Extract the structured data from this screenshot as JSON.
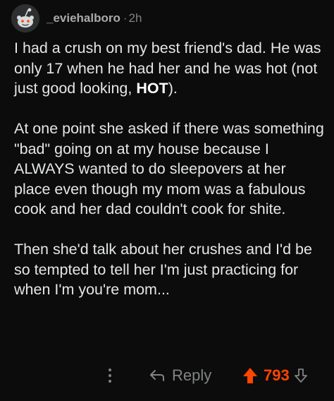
{
  "comment": {
    "author": "_eviehalboro",
    "separator": "·",
    "age": "2h",
    "avatar_icon": "reddit-snoo-avatar-icon",
    "paragraphs": [
      {
        "pre": "I had a crush on my best friend's dad. He was only 17 when he had her and he was hot (not just good looking, ",
        "strong": "HOT",
        "post": ")."
      },
      {
        "pre": "At one point she asked if there was something \"bad\" going on at my house because I ALWAYS wanted to do sleepovers at her place even though my mom was a fabulous cook and her dad couldn't cook for shite.",
        "strong": "",
        "post": ""
      },
      {
        "pre": "Then she'd talk about her crushes and I'd be so tempted to tell her I'm just practicing for when I'm you're mom...",
        "strong": "",
        "post": ""
      }
    ]
  },
  "actions": {
    "more_icon": "vertical-ellipsis-icon",
    "reply_icon": "reply-arrow-icon",
    "reply_label": "Reply",
    "upvote_icon": "upvote-arrow-icon",
    "score": "793",
    "downvote_icon": "downvote-arrow-icon",
    "upvote_color": "#ff4500",
    "muted_color": "#818384"
  }
}
